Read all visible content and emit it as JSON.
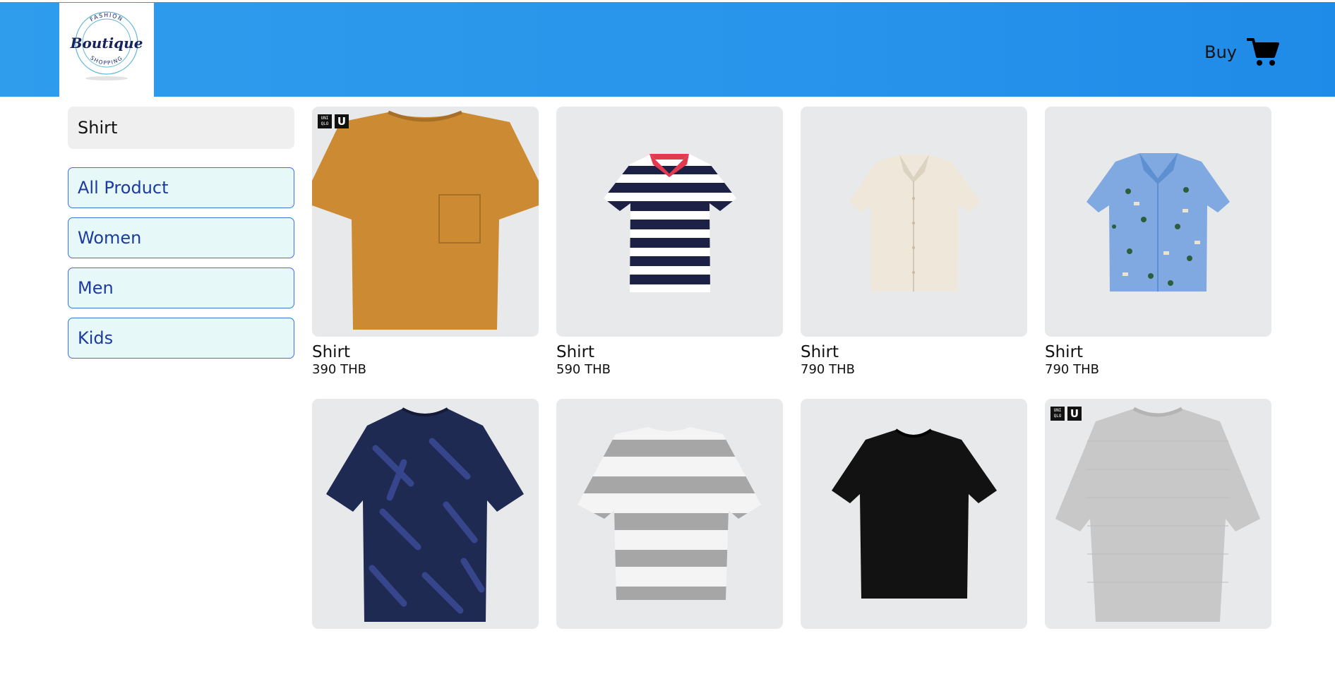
{
  "header": {
    "logo": {
      "top_text": "FASHION",
      "main_text": "Boutique",
      "bottom_text": "SHOPPING"
    },
    "buy_label": "Buy",
    "cart_icon": "cart-icon",
    "background_color": "#2894eb"
  },
  "sidebar": {
    "search": {
      "value": "Shirt"
    },
    "nav": [
      {
        "label": "All Product"
      },
      {
        "label": "Women"
      },
      {
        "label": "Men"
      },
      {
        "label": "Kids"
      }
    ]
  },
  "products": [
    {
      "name": "Shirt",
      "price": "390 THB",
      "color": "#cc8a33",
      "brand_badge": [
        "UNI QLO",
        "U"
      ]
    },
    {
      "name": "Shirt",
      "price": "590 THB",
      "color": "#1c2145"
    },
    {
      "name": "Shirt",
      "price": "790 THB",
      "color": "#efe7da"
    },
    {
      "name": "Shirt",
      "price": "790 THB",
      "color": "#7fa9e0"
    },
    {
      "name": "",
      "price": "",
      "color": "#1f2a52"
    },
    {
      "name": "",
      "price": "",
      "color": "#a6a6a6"
    },
    {
      "name": "",
      "price": "",
      "color": "#121212"
    },
    {
      "name": "",
      "price": "",
      "color": "#c8c8c8",
      "brand_badge": [
        "UNI QLO",
        "U"
      ]
    }
  ]
}
